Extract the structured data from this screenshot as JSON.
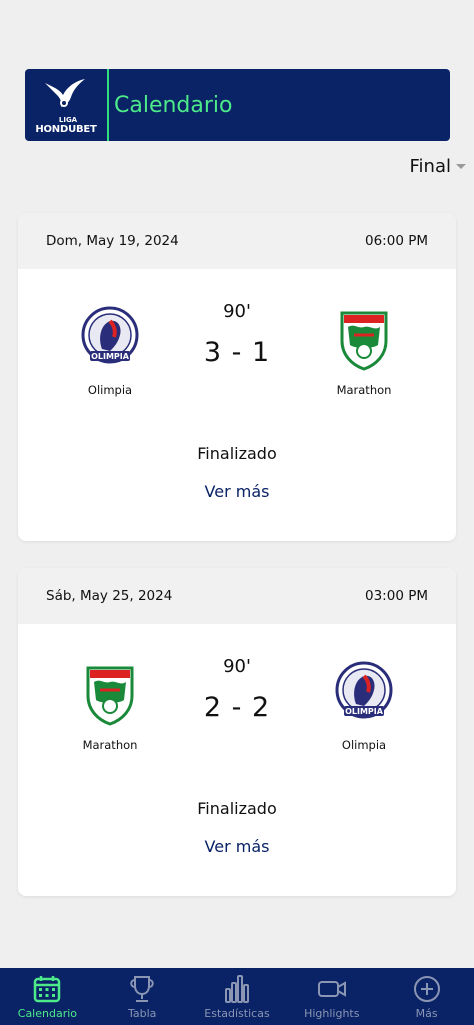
{
  "header": {
    "logo_liga": "LIGA",
    "logo_brand": "HONDUBET",
    "title": "Calendario"
  },
  "filter": {
    "selected": "Final"
  },
  "matches": [
    {
      "date": "Dom, May 19, 2024",
      "time": "06:00 PM",
      "minute": "90'",
      "score": "3 - 1",
      "home": {
        "name": "Olimpia",
        "crest": "olimpia-crest-icon"
      },
      "away": {
        "name": "Marathon",
        "crest": "marathon-crest-icon"
      },
      "status": "Finalizado",
      "more": "Ver más"
    },
    {
      "date": "Sáb, May 25, 2024",
      "time": "03:00 PM",
      "minute": "90'",
      "score": "2 - 2",
      "home": {
        "name": "Marathon",
        "crest": "marathon-crest-icon"
      },
      "away": {
        "name": "Olimpia",
        "crest": "olimpia-crest-icon"
      },
      "status": "Finalizado",
      "more": "Ver más"
    }
  ],
  "nav": {
    "items": [
      {
        "label": "Calendario",
        "icon": "calendar-icon",
        "active": true
      },
      {
        "label": "Tabla",
        "icon": "trophy-icon",
        "active": false
      },
      {
        "label": "Estadísticas",
        "icon": "bar-chart-icon",
        "active": false
      },
      {
        "label": "Highlights",
        "icon": "video-icon",
        "active": false
      },
      {
        "label": "Más",
        "icon": "plus-circle-icon",
        "active": false
      }
    ]
  },
  "colors": {
    "navy": "#0a2266",
    "accent_green": "#4dea8a",
    "nav_inactive": "#8a96b3",
    "background": "#efefef"
  }
}
